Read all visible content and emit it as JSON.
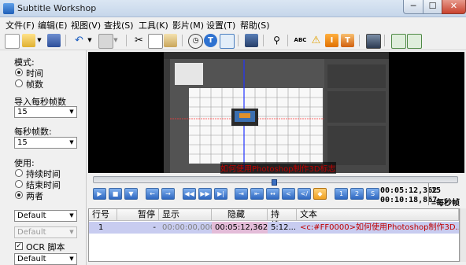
{
  "window": {
    "title": "Subtitle Workshop",
    "min_glyph": "─",
    "max_glyph": "☐",
    "close_glyph": "✕"
  },
  "menu": [
    "文件(F)",
    "编辑(E)",
    "视图(V)",
    "查找(S)",
    "工具(K)",
    "影片(M)",
    "设置(T)",
    "帮助(S)"
  ],
  "toolbar": {
    "icons": [
      "new-file-icon",
      "open-folder-icon",
      "dropdown-arrow-icon",
      "save-icon",
      "undo-icon",
      "dropdown-arrow-icon",
      "translate-icon",
      "dropdown-arrow-icon",
      "cut-icon",
      "copy-icon",
      "paste-icon",
      "clock-icon",
      "text-icon",
      "comment-icon",
      "video-icon",
      "search-icon",
      "spellcheck-icon",
      "warning-icon",
      "info-icon",
      "export-icon",
      "panel-icon",
      "settings-icon",
      "ocr-icon"
    ]
  },
  "left_panel": {
    "mode_label": "模式:",
    "mode_options": [
      "时间",
      "帧数"
    ],
    "mode_selected": 0,
    "import_fps_label": "导入每秒帧数",
    "import_fps_value": "15",
    "fps_label": "每秒帧数:",
    "fps_value": "15",
    "use_label": "使用:",
    "use_options": [
      "持续时间",
      "结束时间",
      "两者"
    ],
    "use_selected": 2,
    "style_value": "Default",
    "style2_value": "Default",
    "ocr_label": "OCR 脚本",
    "ocr_checked": true,
    "ocr_value": "Default"
  },
  "video": {
    "subtitle_text": "如何使用Photoshop制作3D标志",
    "seek_progress": 0.49
  },
  "player": {
    "buttons": [
      "play-button",
      "stop-button",
      "step-back-button",
      "rewind-button",
      "forward-button",
      "prev-subtitle-button",
      "next-subtitle-button",
      "set-start-button",
      "set-end-button",
      "start-sub-button",
      "end-sub-button",
      "sync-button",
      "mark-start-button",
      "mark-end-button",
      "num-1-button",
      "num-2-button",
      "s-button"
    ],
    "current_time": "00:05:12,362",
    "total_time": "00:10:18,867",
    "fps_display": "15",
    "fps_unit": "=每秒帧"
  },
  "table": {
    "headers": [
      "行号",
      "暂停",
      "显示",
      "隐藏",
      "持续...",
      "文本"
    ],
    "rows": [
      {
        "num": "1",
        "pause": "-",
        "show": "00:00:00,000",
        "hide": "00:05:12,362",
        "duration": "5:12...",
        "text": "<c:#FF0000>如何使用Photoshop制作3D..."
      }
    ]
  },
  "colors": {
    "video_bg": "#000000",
    "row_highlight": "#c8ccf0",
    "text_accent": "#c00000",
    "ps_window": "#535353"
  }
}
